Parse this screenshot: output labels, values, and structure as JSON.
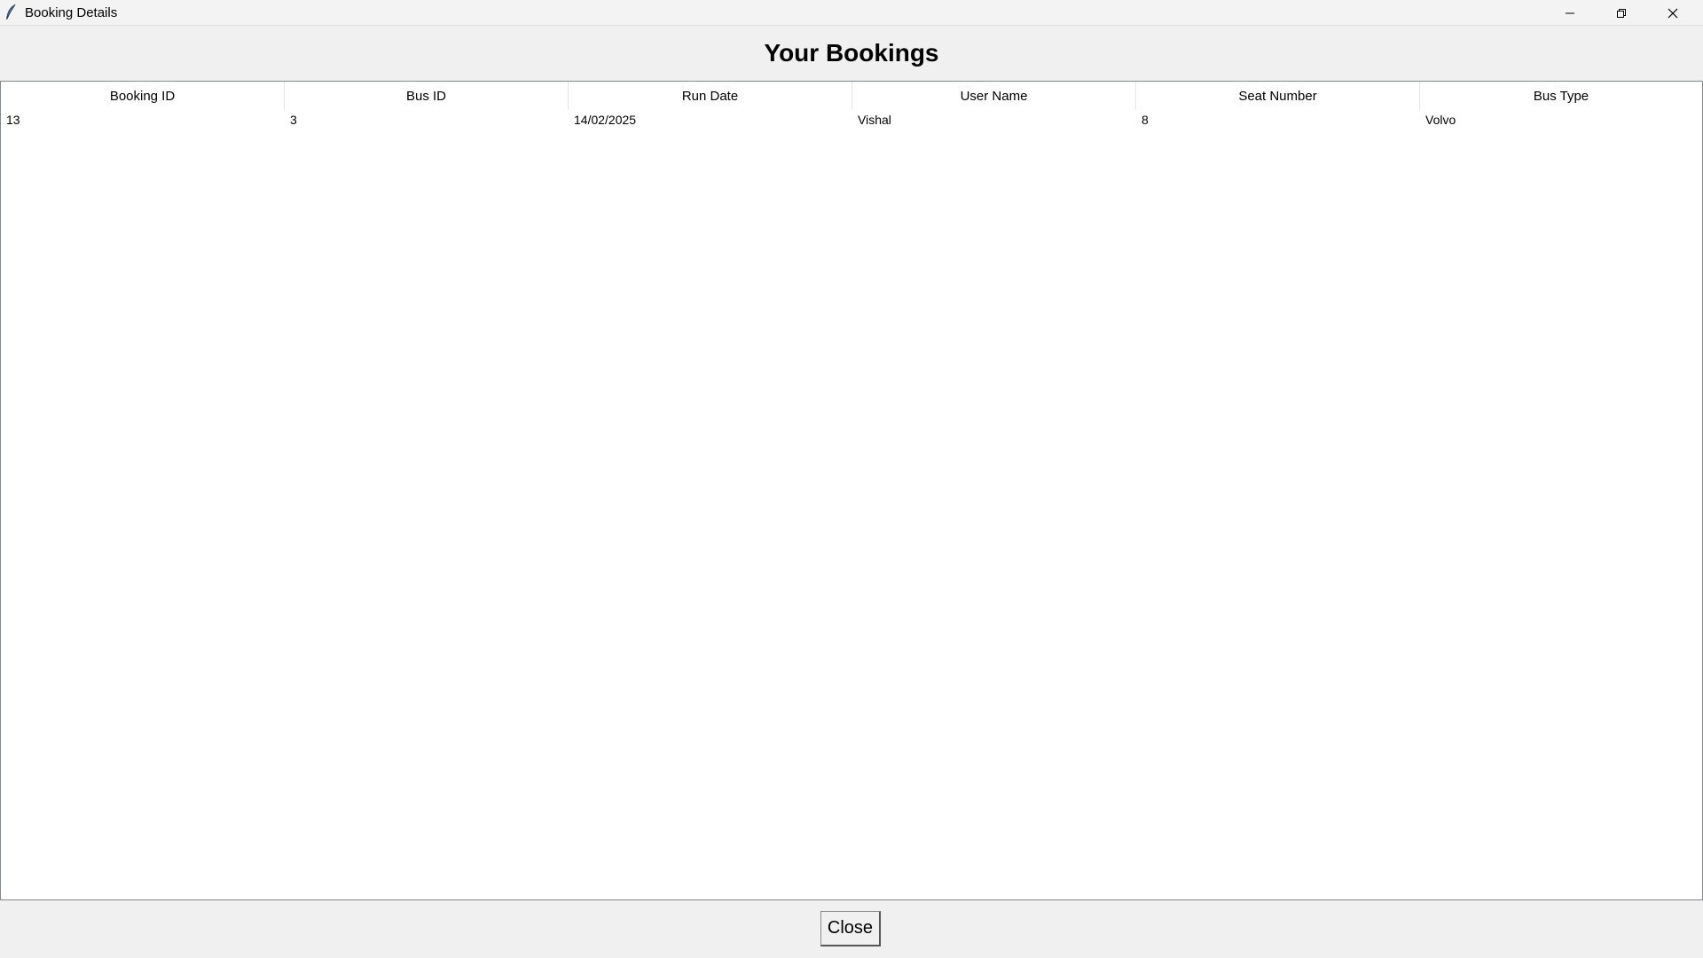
{
  "window": {
    "title": "Booking Details",
    "icon": "feather-icon"
  },
  "heading": "Your Bookings",
  "table": {
    "columns": [
      "Booking ID",
      "Bus ID",
      "Run Date",
      "User Name",
      "Seat Number",
      "Bus Type"
    ],
    "rows": [
      [
        "13",
        "3",
        "14/02/2025",
        "Vishal",
        "8",
        "Volvo"
      ]
    ]
  },
  "footer": {
    "close_label": "Close"
  }
}
